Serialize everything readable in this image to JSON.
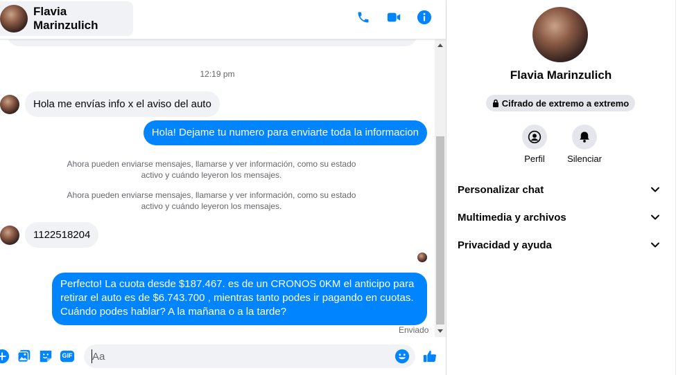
{
  "contact": {
    "name": "Flavia Marinzulich"
  },
  "header": {
    "icons": [
      "phone-icon",
      "video-icon",
      "info-icon"
    ]
  },
  "conversation": {
    "timestamp": "12:19 pm",
    "msg1": "Hola me envías info x el aviso del auto",
    "msg2": "Hola! Dejame tu numero  para enviarte toda la informacion",
    "system_note_1": "Ahora pueden enviarse mensajes, llamarse y ver información, como su estado activo y cuándo leyeron los mensajes.",
    "system_note_2": "Ahora pueden enviarse mensajes, llamarse y ver información, como su estado activo y cuándo leyeron los mensajes.",
    "msg3": "1122518204",
    "msg4": "Perfecto! La cuota desde $187.467. es de un CRONOS 0KM el anticipo para retirar el auto es de $6.743.700 , mientras tanto podes ir pagando en cuotas. Cuándo podes hablar? A la mañana o a la tarde?",
    "status": "Enviado"
  },
  "composer": {
    "placeholder": "Aa",
    "gif_label": "GIF"
  },
  "info_panel": {
    "name": "Flavia Marinzulich",
    "encryption": "Cifrado de extremo a extremo",
    "action_profile": "Perfil",
    "action_mute": "Silenciar",
    "section_customize": "Personalizar chat",
    "section_media": "Multimedia y archivos",
    "section_privacy": "Privacidad y ayuda"
  },
  "colors": {
    "accent": "#0084ff",
    "bubble_in": "#f0f2f5"
  }
}
